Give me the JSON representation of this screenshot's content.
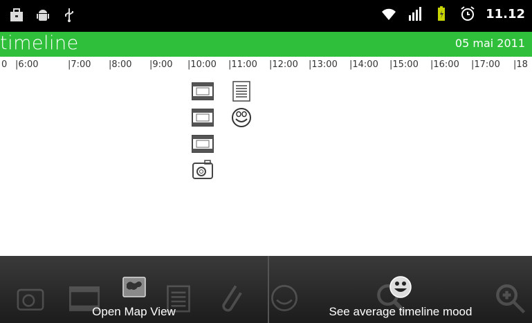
{
  "status_bar": {
    "time": "11.12",
    "icons": [
      "briefcase-icon",
      "android-icon",
      "usb-icon",
      "wifi-icon",
      "signal-icon",
      "battery-icon",
      "alarm-icon"
    ]
  },
  "header": {
    "title": "timeline",
    "date": "05 mai 2011"
  },
  "ruler": {
    "ticks": [
      "0",
      "|6:00",
      "|7:00",
      "|8:00",
      "|9:00",
      "|10:00",
      "|11:00",
      "|12:00",
      "|13:00",
      "|14:00",
      "|15:00",
      "|16:00",
      "|17:00",
      "|18"
    ]
  },
  "timeline_items": [
    {
      "type": "video-icon"
    },
    {
      "type": "video-icon"
    },
    {
      "type": "video-icon"
    },
    {
      "type": "photo-icon"
    },
    {
      "type": "note-icon"
    },
    {
      "type": "mood-icon"
    }
  ],
  "bottom_bar": {
    "open_map_label": "Open Map View",
    "mood_label": "See average timeline mood",
    "background_icons": [
      "camera-icon",
      "film-icon",
      "note-icon",
      "paperclip-icon",
      "smiley-icon",
      "search-icon",
      "zoom-in-icon"
    ]
  },
  "colors": {
    "title_bar": "#2fbf3a",
    "status_bar": "#000000",
    "bottom_bar": "#2a2a2a"
  }
}
